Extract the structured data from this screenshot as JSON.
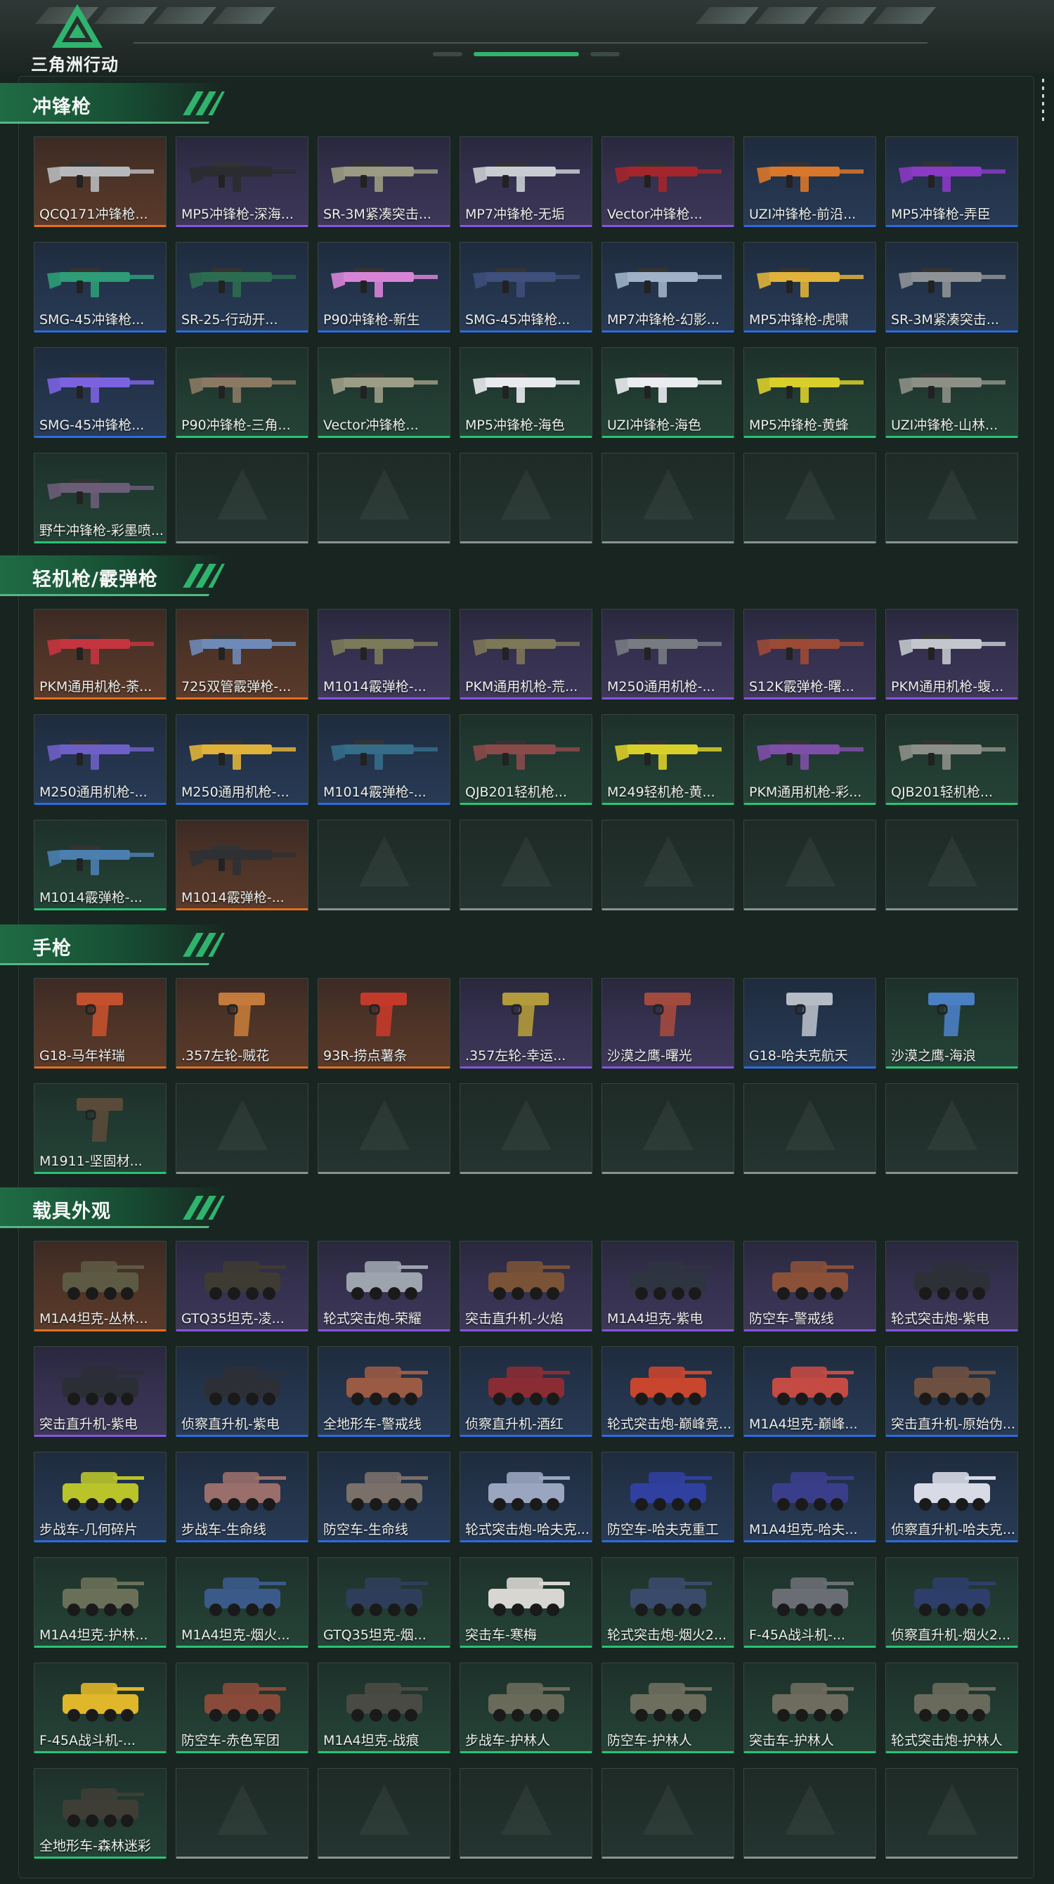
{
  "app": {
    "logo_text": "三角洲行动",
    "colors": {
      "orange": "#e56f1c",
      "purple": "#8655e0",
      "blue": "#2d6be0",
      "green": "#27c474",
      "accent": "#2fb46d"
    }
  },
  "sections": [
    {
      "title": "冲锋枪",
      "icon": "gun",
      "items": [
        {
          "label": "QCQ171冲锋枪...",
          "rarity": "orange",
          "color": "#b7b9bd"
        },
        {
          "label": "MP5冲锋枪-深海...",
          "rarity": "purple",
          "color": "#2a2c30"
        },
        {
          "label": "SR-3M紧凑突击...",
          "rarity": "purple",
          "color": "#9a9b82"
        },
        {
          "label": "MP7冲锋枪-无垢",
          "rarity": "purple",
          "color": "#c9cdd2"
        },
        {
          "label": "Vector冲锋枪...",
          "rarity": "purple",
          "color": "#a4262c"
        },
        {
          "label": "UZI冲锋枪-前沿...",
          "rarity": "blue",
          "color": "#d9772a"
        },
        {
          "label": "MP5冲锋枪-弄臣",
          "rarity": "blue",
          "color": "#8a3ac4"
        },
        {
          "label": "SMG-45冲锋枪...",
          "rarity": "blue",
          "color": "#2d9c77"
        },
        {
          "label": "SR-25-行动开...",
          "rarity": "blue",
          "color": "#2c6b50"
        },
        {
          "label": "P90冲锋枪-新生",
          "rarity": "blue",
          "color": "#d784d6"
        },
        {
          "label": "SMG-45冲锋枪...",
          "rarity": "blue",
          "color": "#3d4f7a"
        },
        {
          "label": "MP7冲锋枪-幻影...",
          "rarity": "blue",
          "color": "#9fb2c7"
        },
        {
          "label": "MP5冲锋枪-虎啸",
          "rarity": "blue",
          "color": "#e0b23a"
        },
        {
          "label": "SR-3M紧凑突击...",
          "rarity": "blue",
          "color": "#8e9297"
        },
        {
          "label": "SMG-45冲锋枪...",
          "rarity": "blue",
          "color": "#7b63e0"
        },
        {
          "label": "P90冲锋枪-三角...",
          "rarity": "green",
          "color": "#8a7a63"
        },
        {
          "label": "Vector冲锋枪...",
          "rarity": "green",
          "color": "#9c9d86"
        },
        {
          "label": "MP5冲锋枪-海色",
          "rarity": "green",
          "color": "#e9eaee"
        },
        {
          "label": "UZI冲锋枪-海色",
          "rarity": "green",
          "color": "#eaecef"
        },
        {
          "label": "MP5冲锋枪-黄蜂",
          "rarity": "green",
          "color": "#d9cf2a"
        },
        {
          "label": "UZI冲锋枪-山林...",
          "rarity": "green",
          "color": "#8d9087"
        },
        {
          "label": "野牛冲锋枪-彩墨喷...",
          "rarity": "green",
          "color": "#6b5d78"
        },
        {
          "empty": true
        },
        {
          "empty": true
        },
        {
          "empty": true
        },
        {
          "empty": true
        },
        {
          "empty": true
        },
        {
          "empty": true
        }
      ]
    },
    {
      "title": "轻机枪/霰弹枪",
      "icon": "gun",
      "items": [
        {
          "label": "PKM通用机枪-荼...",
          "rarity": "orange",
          "color": "#c43540"
        },
        {
          "label": "725双管霰弹枪-...",
          "rarity": "orange",
          "color": "#6f8ab8"
        },
        {
          "label": "M1014霰弹枪-...",
          "rarity": "purple",
          "color": "#7b7a5a"
        },
        {
          "label": "PKM通用机枪-荒...",
          "rarity": "purple",
          "color": "#7d7759"
        },
        {
          "label": "M250通用机枪-...",
          "rarity": "purple",
          "color": "#777b82"
        },
        {
          "label": "S12K霰弹枪-曙...",
          "rarity": "purple",
          "color": "#9b4a36"
        },
        {
          "label": "PKM通用机枪-蝮...",
          "rarity": "purple",
          "color": "#c3c6cc"
        },
        {
          "label": "M250通用机枪-...",
          "rarity": "blue",
          "color": "#6e5fc7"
        },
        {
          "label": "M250通用机枪-...",
          "rarity": "blue",
          "color": "#e0b23a"
        },
        {
          "label": "M1014霰弹枪-...",
          "rarity": "blue",
          "color": "#356c88"
        },
        {
          "label": "QJB201轻机枪...",
          "rarity": "green",
          "color": "#8a4a4a"
        },
        {
          "label": "M249轻机枪-黄...",
          "rarity": "green",
          "color": "#d9cf2a"
        },
        {
          "label": "PKM通用机枪-彩...",
          "rarity": "green",
          "color": "#7e4fa8"
        },
        {
          "label": "QJB201轻机枪...",
          "rarity": "green",
          "color": "#8c8f88"
        },
        {
          "label": "M1014霰弹枪-...",
          "rarity": "green",
          "color": "#4b7fb0"
        },
        {
          "label": "M1014霰弹枪-...",
          "rarity": "orange",
          "color": "#2f3034"
        },
        {
          "empty": true
        },
        {
          "empty": true
        },
        {
          "empty": true
        },
        {
          "empty": true
        },
        {
          "empty": true
        }
      ]
    },
    {
      "title": "手枪",
      "icon": "pistol",
      "items": [
        {
          "label": "G18-马年祥瑞",
          "rarity": "orange",
          "color": "#c4512e"
        },
        {
          "label": ".357左轮-贼花",
          "rarity": "orange",
          "color": "#c47a3a"
        },
        {
          "label": "93R-捞点薯条",
          "rarity": "orange",
          "color": "#c43a2a"
        },
        {
          "label": ".357左轮-幸运...",
          "rarity": "purple",
          "color": "#b39a3a"
        },
        {
          "label": "沙漠之鹰-曙光",
          "rarity": "purple",
          "color": "#a34a3e"
        },
        {
          "label": "G18-哈夫克航天",
          "rarity": "blue",
          "color": "#b5bcc6"
        },
        {
          "label": "沙漠之鹰-海浪",
          "rarity": "green",
          "color": "#4a7fc4"
        },
        {
          "label": "M1911-坚固材...",
          "rarity": "green",
          "color": "#5a4a3a"
        },
        {
          "empty": true
        },
        {
          "empty": true
        },
        {
          "empty": true
        },
        {
          "empty": true
        },
        {
          "empty": true
        },
        {
          "empty": true
        }
      ]
    },
    {
      "title": "载具外观",
      "icon": "vehicle",
      "items": [
        {
          "label": "M1A4坦克-丛林...",
          "rarity": "orange",
          "color": "#5d5a44"
        },
        {
          "label": "GTQ35坦克-凌...",
          "rarity": "purple",
          "color": "#3e3b33"
        },
        {
          "label": "轮式突击炮-荣耀",
          "rarity": "purple",
          "color": "#9da4ae"
        },
        {
          "label": "突击直升机-火焰",
          "rarity": "purple",
          "color": "#7a5236"
        },
        {
          "label": "M1A4坦克-紫电",
          "rarity": "purple",
          "color": "#2e3440"
        },
        {
          "label": "防空车-警戒线",
          "rarity": "purple",
          "color": "#8a5038"
        },
        {
          "label": "轮式突击炮-紫电",
          "rarity": "purple",
          "color": "#2e3038"
        },
        {
          "label": "突击直升机-紫电",
          "rarity": "purple",
          "color": "#2c2e36"
        },
        {
          "label": "侦察直升机-紫电",
          "rarity": "blue",
          "color": "#2d2f36"
        },
        {
          "label": "全地形车-警戒线",
          "rarity": "blue",
          "color": "#9a5a44"
        },
        {
          "label": "侦察直升机-酒红",
          "rarity": "blue",
          "color": "#8a2c34"
        },
        {
          "label": "轮式突击炮-巅峰竞...",
          "rarity": "blue",
          "color": "#c8452e"
        },
        {
          "label": "M1A4坦克-巅峰...",
          "rarity": "blue",
          "color": "#c44a44"
        },
        {
          "label": "突击直升机-原始伪...",
          "rarity": "blue",
          "color": "#6e5040"
        },
        {
          "label": "步战车-几何碎片",
          "rarity": "blue",
          "color": "#b8c42a"
        },
        {
          "label": "步战车-生命线",
          "rarity": "blue",
          "color": "#9a6e6a"
        },
        {
          "label": "防空车-生命线",
          "rarity": "blue",
          "color": "#7a706a"
        },
        {
          "label": "轮式突击炮-哈夫克...",
          "rarity": "blue",
          "color": "#9aa6c0"
        },
        {
          "label": "防空车-哈夫克重工",
          "rarity": "blue",
          "color": "#3040a0"
        },
        {
          "label": "M1A4坦克-哈夫...",
          "rarity": "blue",
          "color": "#3a3e8a"
        },
        {
          "label": "侦察直升机-哈夫克...",
          "rarity": "blue",
          "color": "#d8dae6"
        },
        {
          "label": "M1A4坦克-护林...",
          "rarity": "green",
          "color": "#6a7058"
        },
        {
          "label": "M1A4坦克-烟火...",
          "rarity": "green",
          "color": "#3a5a8a"
        },
        {
          "label": "GTQ35坦克-烟...",
          "rarity": "green",
          "color": "#2e3e5a"
        },
        {
          "label": "突击车-寒梅",
          "rarity": "green",
          "color": "#d8d6d2"
        },
        {
          "label": "轮式突击炮-烟火2...",
          "rarity": "green",
          "color": "#3a4a6a"
        },
        {
          "label": "F-45A战斗机-...",
          "rarity": "green",
          "color": "#6a6e74"
        },
        {
          "label": "侦察直升机-烟火2...",
          "rarity": "green",
          "color": "#2e3e6a"
        },
        {
          "label": "F-45A战斗机-...",
          "rarity": "green",
          "color": "#e0b62a"
        },
        {
          "label": "防空车-赤色军团",
          "rarity": "green",
          "color": "#8a4a3a"
        },
        {
          "label": "M1A4坦克-战痕",
          "rarity": "green",
          "color": "#4a4a44"
        },
        {
          "label": "步战车-护林人",
          "rarity": "green",
          "color": "#6a6a5a"
        },
        {
          "label": "防空车-护林人",
          "rarity": "green",
          "color": "#6e6e5e"
        },
        {
          "label": "突击车-护林人",
          "rarity": "green",
          "color": "#6e6c5e"
        },
        {
          "label": "轮式突击炮-护林人",
          "rarity": "green",
          "color": "#6a6a5c"
        },
        {
          "label": "全地形车-森林迷彩",
          "rarity": "green",
          "color": "#3e3e36"
        },
        {
          "empty": true
        },
        {
          "empty": true
        },
        {
          "empty": true
        },
        {
          "empty": true
        },
        {
          "empty": true
        },
        {
          "empty": true
        }
      ]
    }
  ]
}
